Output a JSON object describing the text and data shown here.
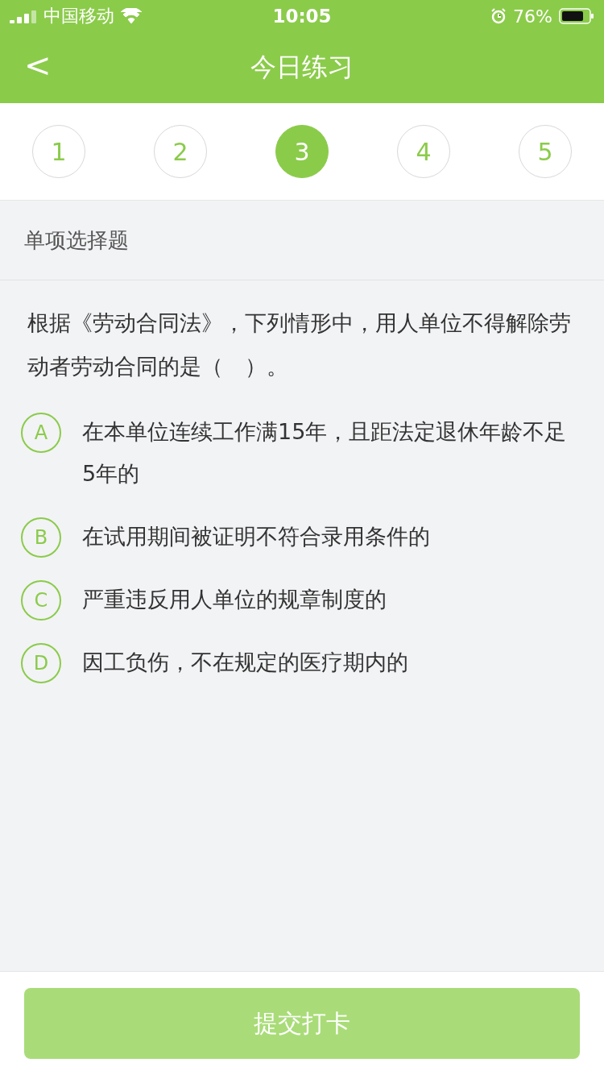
{
  "status_bar": {
    "carrier": "中国移动",
    "time": "10:05",
    "battery": "76%"
  },
  "header": {
    "back": "<",
    "title": "今日练习"
  },
  "steps": [
    {
      "label": "1",
      "selected": false
    },
    {
      "label": "2",
      "selected": false
    },
    {
      "label": "3",
      "selected": true
    },
    {
      "label": "4",
      "selected": false
    },
    {
      "label": "5",
      "selected": false
    }
  ],
  "section": "单项选择题",
  "question": "根据《劳动合同法》，下列情形中，用人单位不得解除劳动者劳动合同的是（　）。",
  "options": [
    {
      "letter": "A",
      "text": "在本单位连续工作满15年，且距法定退休年龄不足5年的",
      "selected": false
    },
    {
      "letter": "B",
      "text": "在试用期间被证明不符合录用条件的",
      "selected": false
    },
    {
      "letter": "C",
      "text": "严重违反用人单位的规章制度的",
      "selected": false
    },
    {
      "letter": "D",
      "text": "因工负伤，不在规定的医疗期内的",
      "selected": false
    }
  ],
  "submit": {
    "label": "提交打卡",
    "disabled": true
  }
}
